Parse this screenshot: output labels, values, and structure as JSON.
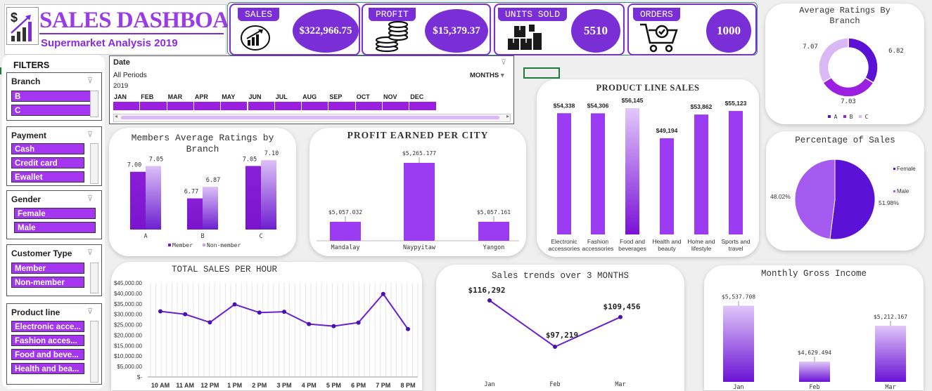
{
  "header": {
    "title": "SALES DASHBOARD",
    "subtitle": "Supermarket Analysis 2019",
    "logo_icon": "dollar-growth-chart-icon"
  },
  "kpis": [
    {
      "label": "SALES",
      "value": "$322,966.75",
      "icon": "growth-chart-icon"
    },
    {
      "label": "PROFIT",
      "value": "$15,379.37",
      "icon": "coin-stack-icon"
    },
    {
      "label": "UNITS SOLD",
      "value": "5510",
      "icon": "boxes-icon"
    },
    {
      "label": "ORDERS",
      "value": "1000",
      "icon": "cart-check-icon"
    }
  ],
  "filters": {
    "title": "FILTERS",
    "branch": {
      "label": "Branch",
      "items": [
        "B",
        "C"
      ]
    },
    "payment": {
      "label": "Payment",
      "items": [
        "Cash",
        "Credit card",
        "Ewallet"
      ]
    },
    "gender": {
      "label": "Gender",
      "items": [
        "Female",
        "Male"
      ]
    },
    "customer_type": {
      "label": "Customer Type",
      "items": [
        "Member",
        "Non-member"
      ]
    },
    "product_line": {
      "label": "Product line",
      "items": [
        "Electronic acce...",
        "Fashion acces...",
        "Food and beve...",
        "Health and bea..."
      ]
    }
  },
  "timeline": {
    "label": "Date",
    "period": "All Periods",
    "unit": "MONTHS",
    "year": "2019",
    "months": [
      "JAN",
      "FEB",
      "MAR",
      "APR",
      "MAY",
      "JUN",
      "JUL",
      "AUG",
      "SEP",
      "OCT",
      "NOV",
      "DEC"
    ]
  },
  "accent_colors": {
    "primary": "#7a2fd6",
    "bright": "#9a1fe0",
    "light": "#d9b8f5",
    "dark": "#5b12d6"
  },
  "chart_data": [
    {
      "id": "avg_ratings_branch",
      "type": "pie",
      "title": "Average Ratings By Branch",
      "categories": [
        "A",
        "B",
        "C"
      ],
      "values": [
        7.07,
        6.82,
        7.03
      ],
      "labels": [
        "7.07",
        "6.82",
        "7.03"
      ],
      "legend": "bottom"
    },
    {
      "id": "members_avg_ratings",
      "type": "bar",
      "title": "Members Average Ratings by Branch",
      "categories": [
        "A",
        "B",
        "C"
      ],
      "series": [
        {
          "name": "Member",
          "values": [
            7.0,
            6.77,
            7.05
          ],
          "labels": [
            "7.00",
            "6.77",
            "7.05"
          ]
        },
        {
          "name": "Non-member",
          "values": [
            7.05,
            6.87,
            7.1
          ],
          "labels": [
            "7.05",
            "6.87",
            "7.10"
          ]
        }
      ],
      "ylim": [
        6.5,
        7.15
      ],
      "legend": "bottom"
    },
    {
      "id": "profit_per_city",
      "type": "bar",
      "title": "PROFIT EARNED PER CITY",
      "categories": [
        "Mandalay",
        "Naypyitaw",
        "Yangon"
      ],
      "values": [
        5057.032,
        5265.177,
        5057.161
      ],
      "labels": [
        "$5,057.032",
        "$5,265.177",
        "$5,057.161"
      ],
      "ylim": [
        4990,
        5280
      ]
    },
    {
      "id": "product_line_sales",
      "type": "bar",
      "title": "PRODUCT LINE SALES",
      "categories": [
        "Electronic accessories",
        "Fashion accessories",
        "Food and beverages",
        "Health and beauty",
        "Home and lifestyle",
        "Sports and travel"
      ],
      "values": [
        54338,
        54306,
        56145,
        49194,
        53862,
        55123
      ],
      "labels": [
        "$54,338",
        "$54,306",
        "$56,145",
        "$49,194",
        "$53,862",
        "$55,123"
      ],
      "ylim": [
        0,
        57000
      ]
    },
    {
      "id": "percentage_of_sales",
      "type": "pie",
      "title": "Percentage of Sales",
      "categories": [
        "Female",
        "Male"
      ],
      "values": [
        51.98,
        48.02
      ],
      "labels": [
        "51.98%",
        "48.02%"
      ],
      "legend": "right"
    },
    {
      "id": "total_sales_per_hour",
      "type": "line",
      "title": "TOTAL SALES PER HOUR",
      "categories": [
        "10 AM",
        "11 AM",
        "12 PM",
        "1 PM",
        "2 PM",
        "3 PM",
        "4 PM",
        "5 PM",
        "6 PM",
        "7 PM",
        "8 PM"
      ],
      "values": [
        31400,
        30000,
        26100,
        34700,
        30800,
        31200,
        25300,
        24300,
        26000,
        39700,
        22900
      ],
      "yticks": [
        "$45,000.00",
        "$40,000.00",
        "$35,000.00",
        "$30,000.00",
        "$25,000.00",
        "$20,000.00",
        "$15,000.00",
        "$10,000.00",
        "$5,000.00",
        "$-"
      ],
      "ylim": [
        0,
        45000
      ],
      "grid": true
    },
    {
      "id": "sales_trends_3_months",
      "type": "line",
      "title": "Sales trends over 3 MONTHS",
      "categories": [
        "Jan",
        "Feb",
        "Mar"
      ],
      "values": [
        116292,
        97219,
        109456
      ],
      "labels": [
        "$116,292",
        "$97,219",
        "$109,456"
      ],
      "ylim": [
        95000,
        120000
      ]
    },
    {
      "id": "monthly_gross_income",
      "type": "bar",
      "title": "Monthly Gross Income",
      "categories": [
        "Jan",
        "Feb",
        "Mar"
      ],
      "values": [
        5537.708,
        4629.494,
        5212.167
      ],
      "labels": [
        "$5,537.708",
        "$4,629.494",
        "$5,212.167"
      ],
      "ylim": [
        4300,
        5600
      ]
    }
  ]
}
